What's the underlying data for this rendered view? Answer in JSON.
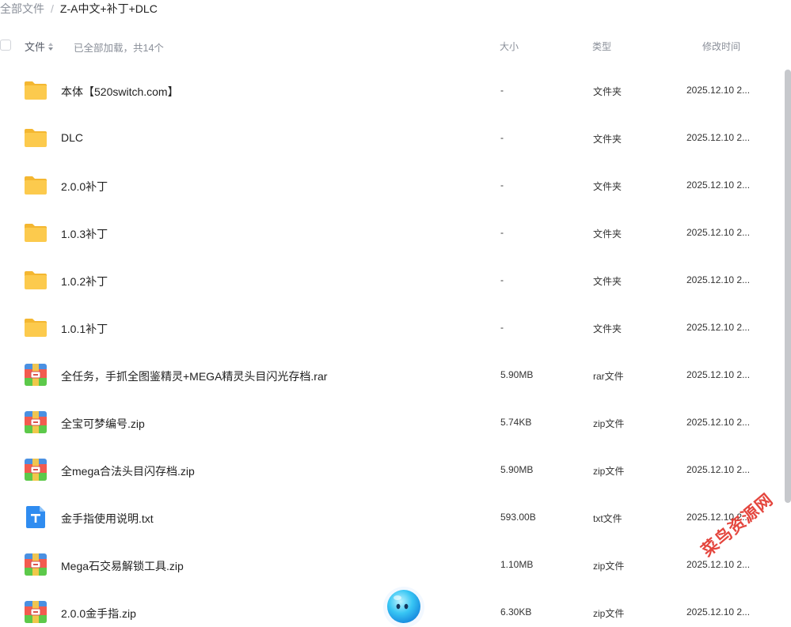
{
  "breadcrumb": {
    "root": "全部文件",
    "separator": "/",
    "current": "Z-A中文+补丁+DLC"
  },
  "header": {
    "name_label": "文件",
    "loaded_text": "已全部加载，共14个",
    "size_label": "大小",
    "type_label": "类型",
    "time_label": "修改时间"
  },
  "rows": [
    {
      "icon": "folder-icon",
      "name": "本体【520switch.com】",
      "size": "-",
      "type": "文件夹",
      "time": "2025.12.10 2..."
    },
    {
      "icon": "folder-icon",
      "name": "DLC",
      "size": "-",
      "type": "文件夹",
      "time": "2025.12.10 2..."
    },
    {
      "icon": "folder-icon",
      "name": "2.0.0补丁",
      "size": "-",
      "type": "文件夹",
      "time": "2025.12.10 2..."
    },
    {
      "icon": "folder-icon",
      "name": "1.0.3补丁",
      "size": "-",
      "type": "文件夹",
      "time": "2025.12.10 2..."
    },
    {
      "icon": "folder-icon",
      "name": "1.0.2补丁",
      "size": "-",
      "type": "文件夹",
      "time": "2025.12.10 2..."
    },
    {
      "icon": "folder-icon",
      "name": "1.0.1补丁",
      "size": "-",
      "type": "文件夹",
      "time": "2025.12.10 2..."
    },
    {
      "icon": "archive-icon",
      "name": "全任务，手抓全图鉴精灵+MEGA精灵头目闪光存档.rar",
      "size": "5.90MB",
      "type": "rar文件",
      "time": "2025.12.10 2..."
    },
    {
      "icon": "archive-icon",
      "name": "全宝可梦编号.zip",
      "size": "5.74KB",
      "type": "zip文件",
      "time": "2025.12.10 2..."
    },
    {
      "icon": "archive-icon",
      "name": "全mega合法头目闪存档.zip",
      "size": "5.90MB",
      "type": "zip文件",
      "time": "2025.12.10 2..."
    },
    {
      "icon": "text-file-icon",
      "name": "金手指使用说明.txt",
      "size": "593.00B",
      "type": "txt文件",
      "time": "2025.12.10 2..."
    },
    {
      "icon": "archive-icon",
      "name": "Mega石交易解锁工具.zip",
      "size": "1.10MB",
      "type": "zip文件",
      "time": "2025.12.10 2..."
    },
    {
      "icon": "archive-icon",
      "name": "2.0.0金手指.zip",
      "size": "6.30KB",
      "type": "zip文件",
      "time": "2025.12.10 2..."
    }
  ],
  "watermark": "菜鸟资源网",
  "colors": {
    "folder": "#fcca4d",
    "archive_blue": "#4a90e2",
    "archive_red": "#f35b4f",
    "archive_green": "#5cc94a",
    "text_file": "#2f8cf0",
    "watermark": "#e2322a"
  }
}
